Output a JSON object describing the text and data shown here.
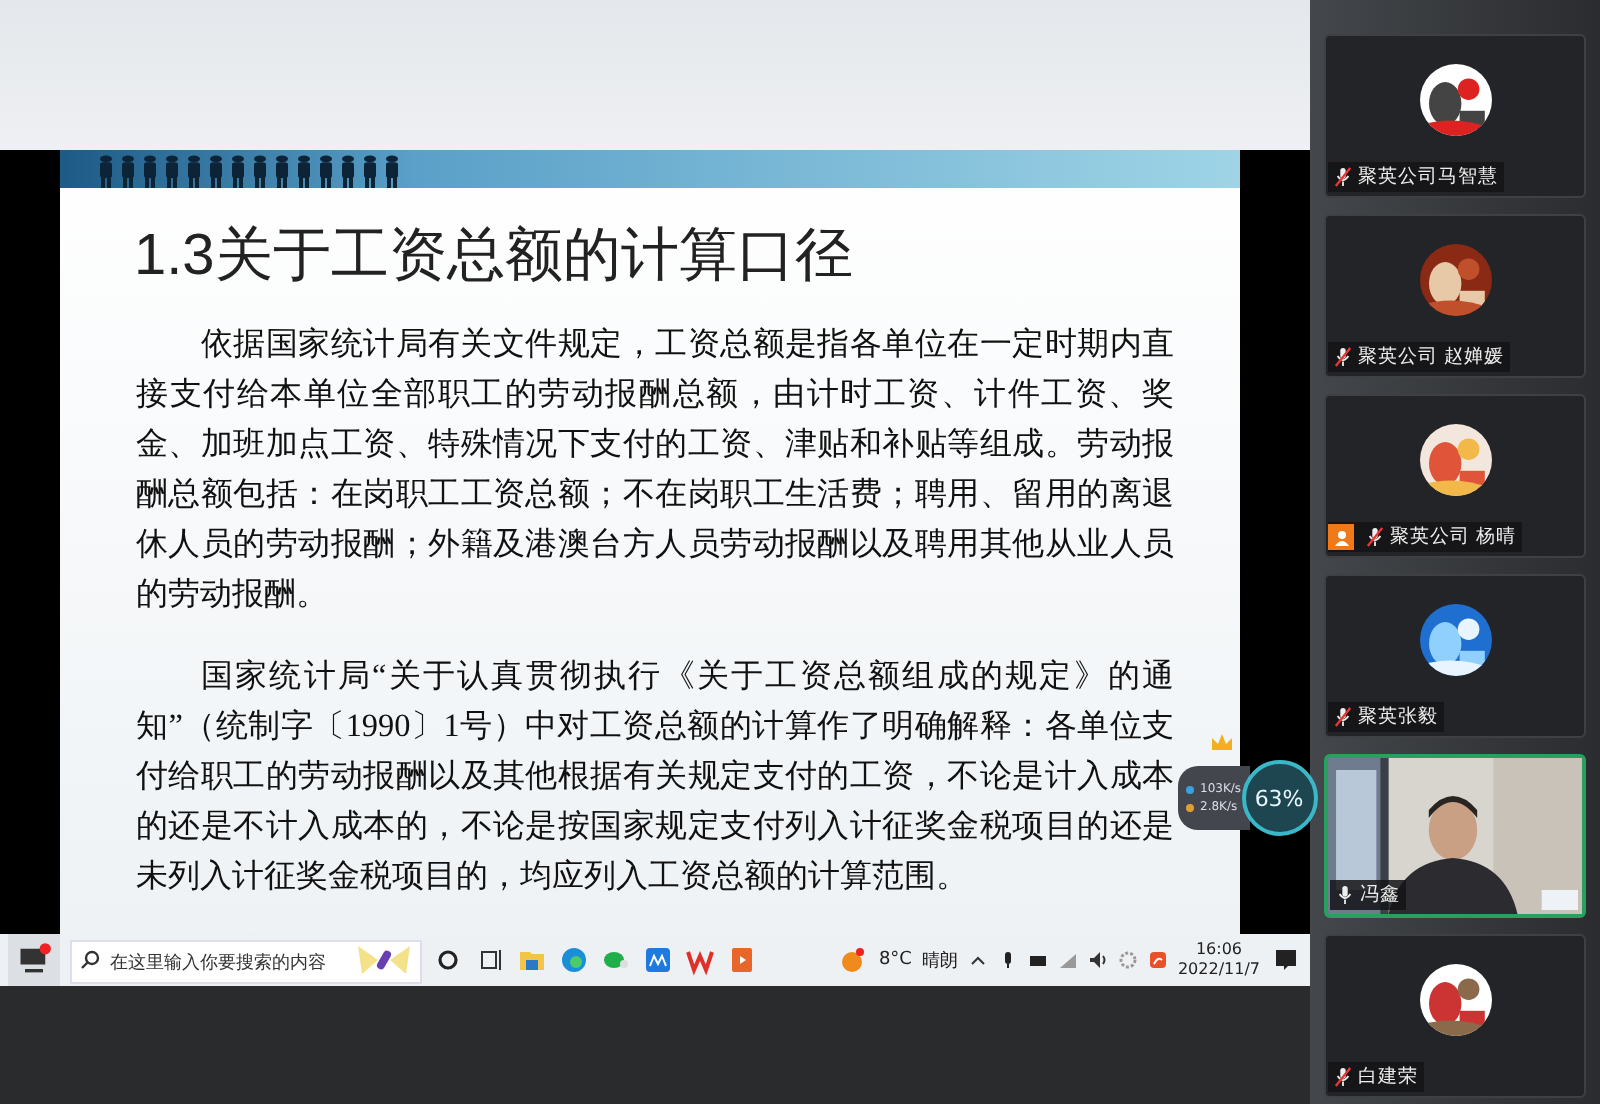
{
  "slide": {
    "title": "1.3关于工资总额的计算口径",
    "paragraphs": [
      "依据国家统计局有关文件规定，工资总额是指各单位在一定时期内直接支付给本单位全部职工的劳动报酬总额，由计时工资、计件工资、奖金、加班加点工资、特殊情况下支付的工资、津贴和补贴等组成。劳动报酬总额包括：在岗职工工资总额；不在岗职工生活费；聘用、留用的离退休人员的劳动报酬；外籍及港澳台方人员劳动报酬以及聘用其他从业人员的劳动报酬。",
      "国家统计局“关于认真贯彻执行《关于工资总额组成的规定》的通知”（统制字〔1990〕1号）中对工资总额的计算作了明确解释：各单位支付给职工的劳动报酬以及其他根据有关规定支付的工资，不论是计入成本的还是不计入成本的，不论是按国家规定支付列入计征奖金税项目的还是未列入计征奖金税项目的，均应列入工资总额的计算范围。"
    ]
  },
  "network_widget": {
    "upload": "103K/s",
    "download": "2.8K/s",
    "usage": "63%"
  },
  "taskbar": {
    "search": {
      "placeholder": "在这里输入你要搜索的内容"
    },
    "weather": {
      "temperature": "8°C",
      "condition": "晴朗"
    },
    "time": "16:06",
    "date": "2022/11/7"
  },
  "participants": [
    {
      "name": "聚英公司马智慧",
      "kind": "avatar",
      "muted": true,
      "speaking": false,
      "host": false
    },
    {
      "name": "聚英公司 赵婵媛",
      "kind": "avatar",
      "muted": true,
      "speaking": false,
      "host": false
    },
    {
      "name": "聚英公司 杨晴",
      "kind": "avatar",
      "muted": true,
      "speaking": false,
      "host": true
    },
    {
      "name": "聚英张毅",
      "kind": "avatar",
      "muted": true,
      "speaking": false,
      "host": false
    },
    {
      "name": "冯鑫",
      "kind": "video",
      "muted": false,
      "speaking": true,
      "host": false
    },
    {
      "name": "白建荣",
      "kind": "avatar",
      "muted": true,
      "speaking": false,
      "host": false
    }
  ]
}
